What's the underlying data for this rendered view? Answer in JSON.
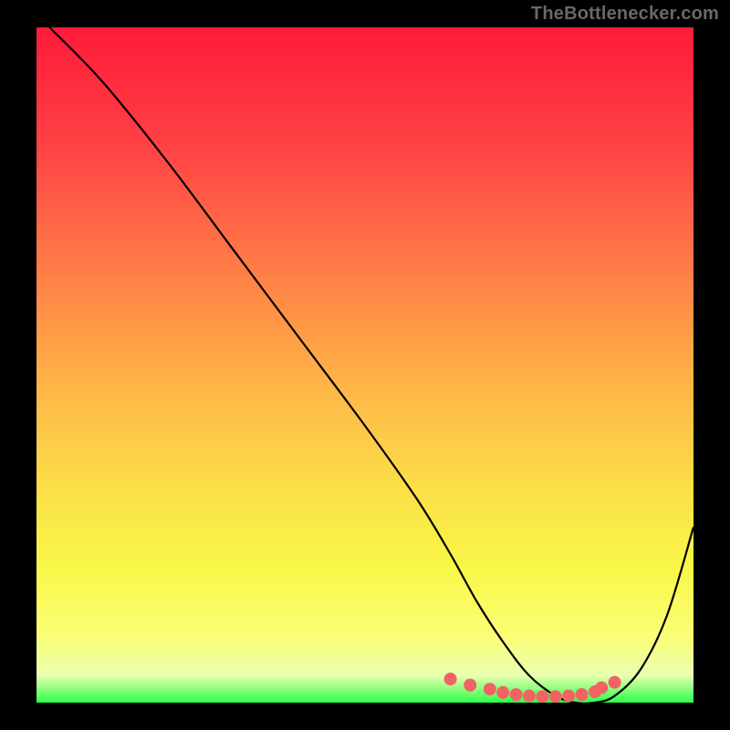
{
  "watermark": "TheBottlenecker.com",
  "colors": {
    "page_bg": "#000000",
    "gradient_stops": [
      {
        "offset": 0.0,
        "color": "#ff1a3a"
      },
      {
        "offset": 0.18,
        "color": "#ff4345"
      },
      {
        "offset": 0.35,
        "color": "#ff7a47"
      },
      {
        "offset": 0.52,
        "color": "#ffb247"
      },
      {
        "offset": 0.68,
        "color": "#fbde48"
      },
      {
        "offset": 0.8,
        "color": "#f9f748"
      },
      {
        "offset": 0.9,
        "color": "#faff75"
      },
      {
        "offset": 0.96,
        "color": "#eaffb0"
      },
      {
        "offset": 1.0,
        "color": "#2cff4a"
      }
    ],
    "curve_stroke": "#000000",
    "marker_fill": "#f26363",
    "marker_stroke": "#f26363"
  },
  "chart_data": {
    "type": "line",
    "title": "",
    "xlabel": "",
    "ylabel": "",
    "xlim": [
      0,
      100
    ],
    "ylim": [
      0,
      100
    ],
    "series": [
      {
        "name": "bottleneck-curve",
        "x": [
          2,
          10,
          20,
          30,
          40,
          50,
          58,
          63,
          67,
          71,
          75,
          79,
          82,
          85,
          88,
          92,
          96,
          100
        ],
        "y": [
          100,
          92,
          80,
          67,
          54,
          41,
          30,
          22,
          15,
          9,
          4,
          1,
          0,
          0,
          1,
          5,
          13,
          26
        ]
      }
    ],
    "markers": {
      "name": "bottom-cluster",
      "x": [
        63,
        66,
        69,
        71,
        73,
        75,
        77,
        79,
        81,
        83,
        85,
        86,
        88
      ],
      "y": [
        3.5,
        2.6,
        2.0,
        1.5,
        1.2,
        1.0,
        0.9,
        0.9,
        1.0,
        1.2,
        1.6,
        2.2,
        3.0
      ]
    }
  }
}
